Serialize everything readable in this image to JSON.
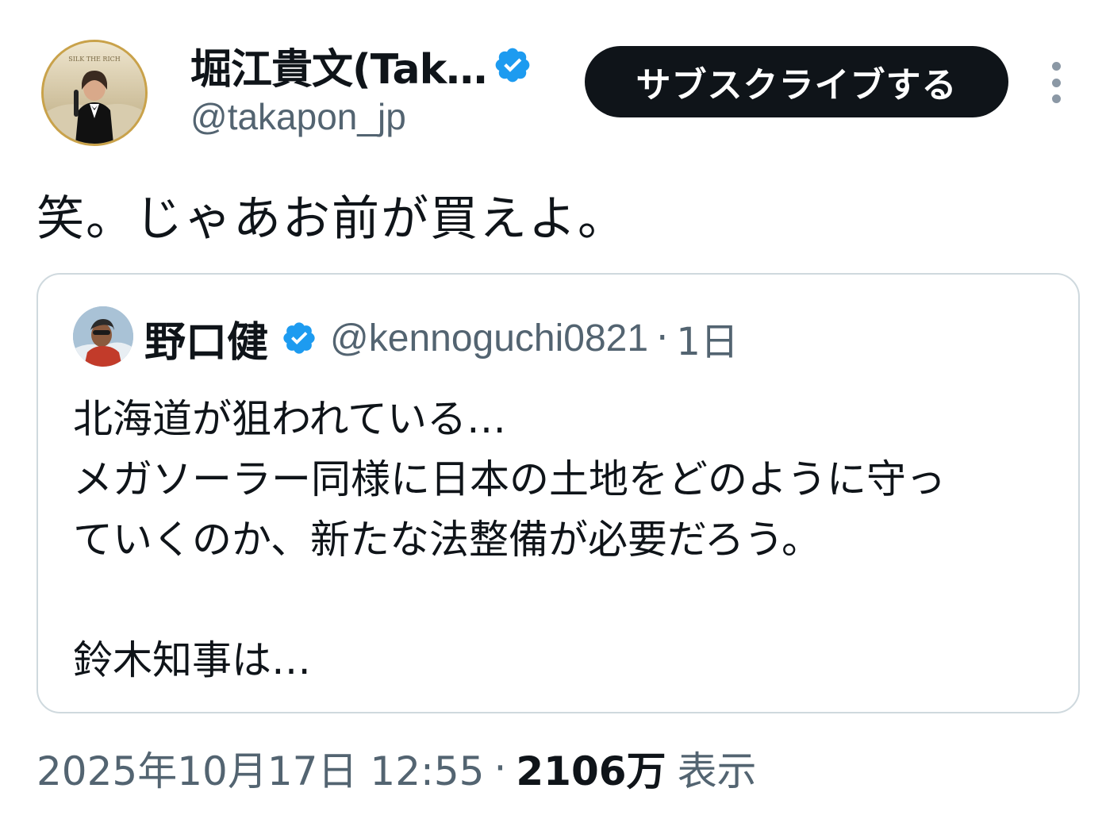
{
  "author": {
    "name": "堀江貴文(Tak…",
    "handle": "@takapon_jp",
    "avatar_banner_text": "SILK THE RICH",
    "verified": true
  },
  "actions": {
    "subscribe_label": "サブスクライブする",
    "more_icon": "more-vertical-icon"
  },
  "tweet": {
    "text": "笑。じゃあお前が買えよ。"
  },
  "quote": {
    "name": "野口健",
    "verified": true,
    "handle": "@kennoguchi0821",
    "separator": "·",
    "time": "1日",
    "text": "北海道が狙われている…\nメガソーラー同様に日本の土地をどのように守っ\nていくのか、新たな法整備が必要だろう。\n\n鈴木知事は…"
  },
  "meta": {
    "timestamp": "2025年10月17日 12:55",
    "separator": "·",
    "views_count": "2106万",
    "views_label": "表示"
  },
  "colors": {
    "text_primary": "#0f1419",
    "text_secondary": "#536471",
    "verified_blue": "#1d9bf0",
    "border": "#cfd9de",
    "button_bg": "#0f1419",
    "button_text": "#ffffff"
  }
}
